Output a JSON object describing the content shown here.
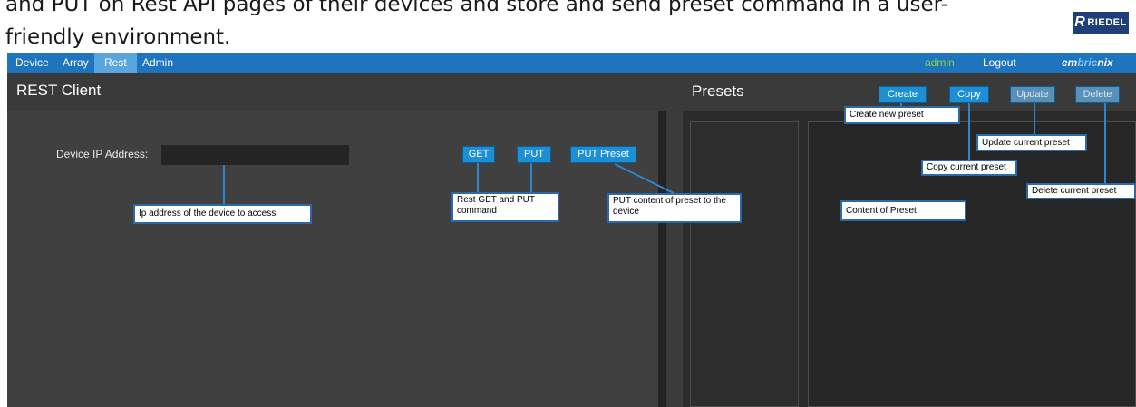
{
  "doc": {
    "line1": "and PUT on Rest API pages of their devices and store and send preset command in a user-",
    "line2": "friendly environment.",
    "logo_text": "RIEDEL",
    "logo_mark": "R"
  },
  "nav": {
    "items": [
      {
        "label": "Device"
      },
      {
        "label": "Array"
      },
      {
        "label": "Rest"
      },
      {
        "label": "Admin"
      }
    ],
    "active": "Rest",
    "user": "admin",
    "logout": "Logout",
    "brand_pre": "em",
    "brand_mid": "bric",
    "brand_post": "nix"
  },
  "rest_client": {
    "title": "REST Client",
    "ip_label": "Device IP Address:",
    "ip_value": "",
    "buttons": {
      "get": "GET",
      "put": "PUT",
      "put_preset": "PUT Preset"
    }
  },
  "presets": {
    "title": "Presets",
    "buttons": {
      "create": "Create",
      "copy": "Copy",
      "update": "Update",
      "delete": "Delete"
    }
  },
  "annotations": {
    "ip": "Ip address of the device to access",
    "rest_cmd": "Rest GET and PUT command",
    "put_preset": "PUT content of preset to the device",
    "create": "Create new preset",
    "update": "Update current preset",
    "copy": "Copy current preset",
    "delete": "Delete current preset",
    "content": "Content of Preset"
  },
  "colors": {
    "navbar": "#1e75bd",
    "active_tab": "#5aa5de",
    "button": "#1c8fd5",
    "user_text": "#8fd13f",
    "callout_border": "#2a6aab"
  }
}
